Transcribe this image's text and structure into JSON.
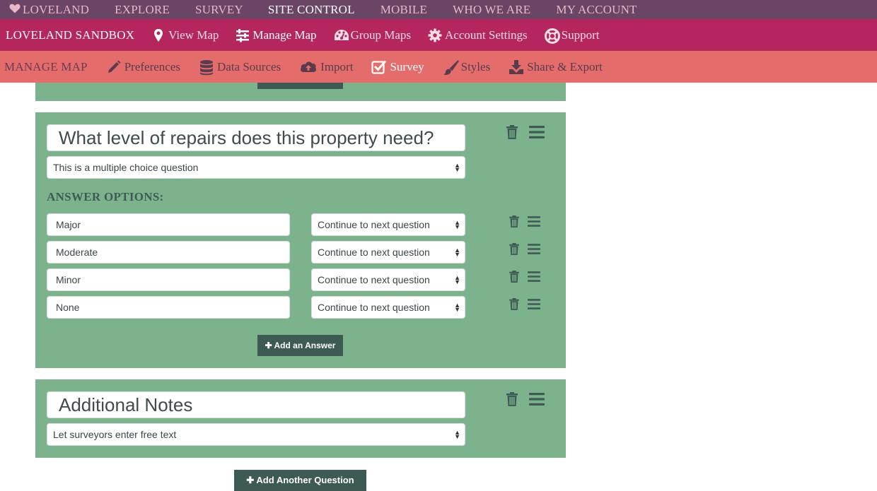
{
  "topnav": {
    "items": [
      "LOVELAND",
      "EXPLORE",
      "SURVEY",
      "SITE CONTROL",
      "MOBILE",
      "WHO WE ARE",
      "MY ACCOUNT"
    ],
    "active": "SITE CONTROL"
  },
  "subnav": {
    "brand": "LOVELAND SANDBOX",
    "items": [
      "View Map",
      "Manage Map",
      "Group Maps",
      "Account Settings",
      "Support"
    ],
    "active": "Manage Map"
  },
  "mapnav": {
    "label": "MANAGE MAP",
    "items": [
      "Preferences",
      "Data Sources",
      "Import",
      "Survey",
      "Styles",
      "Share & Export"
    ],
    "active": "Survey"
  },
  "questions": [
    {
      "title": "What level of repairs does this property need?",
      "type": "This is a multiple choice question",
      "answers_heading": "ANSWER OPTIONS:",
      "answers": [
        {
          "label": "Major",
          "action": "Continue to next question"
        },
        {
          "label": "Moderate",
          "action": "Continue to next question"
        },
        {
          "label": "Minor",
          "action": "Continue to next question"
        },
        {
          "label": "None",
          "action": "Continue to next question"
        }
      ],
      "add_answer_label": "Add an Answer"
    },
    {
      "title": "Additional Notes",
      "type": "Let surveyors enter free text"
    }
  ],
  "add_question_label": "Add Another Question",
  "colors": {
    "topnav_bg": "#6b4565",
    "subnav_bg": "#b5265f",
    "mapnav_bg": "#e46c6a",
    "card_bg": "#7db38c",
    "button_bg": "#3e5a55"
  },
  "icons": {
    "heart": "heart-icon",
    "map_marker": "map-marker-icon",
    "sliders": "sliders-icon",
    "dashboard": "dashboard-icon",
    "gear": "gear-icon",
    "life_ring": "life-ring-icon",
    "pencil": "pencil-icon",
    "database": "database-icon",
    "cloud_upload": "cloud-upload-icon",
    "check_square": "check-square-icon",
    "paintbrush": "paintbrush-icon",
    "download": "download-icon",
    "trash": "trash-icon",
    "drag_handle": "drag-handle-icon",
    "plus": "plus-icon"
  }
}
